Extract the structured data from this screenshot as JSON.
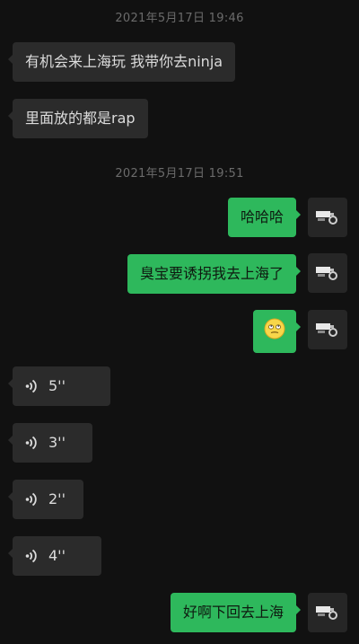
{
  "timestamps": [
    "2021年5月17日 19:46",
    "2021年5月17日 19:51"
  ],
  "messages": [
    {
      "side": "in",
      "type": "text",
      "text": "有机会来上海玩 我带你去ninja"
    },
    {
      "side": "in",
      "type": "text",
      "text": "里面放的都是rap"
    },
    {
      "side": "out",
      "type": "text",
      "text": "哈哈哈"
    },
    {
      "side": "out",
      "type": "text",
      "text": "臭宝要诱拐我去上海了"
    },
    {
      "side": "out",
      "type": "emoji",
      "icon": "dizzy-face-emoji"
    },
    {
      "side": "in",
      "type": "voice",
      "duration": "5''"
    },
    {
      "side": "in",
      "type": "voice",
      "duration": "3''"
    },
    {
      "side": "in",
      "type": "voice",
      "duration": "2''"
    },
    {
      "side": "in",
      "type": "voice",
      "duration": "4''"
    },
    {
      "side": "out",
      "type": "text",
      "text": "好啊下回去上海"
    }
  ],
  "colors": {
    "background": "#111111",
    "incoming_bubble": "#2b2b2b",
    "outgoing_bubble": "#2eb85c",
    "timestamp": "#6b6b6b"
  }
}
